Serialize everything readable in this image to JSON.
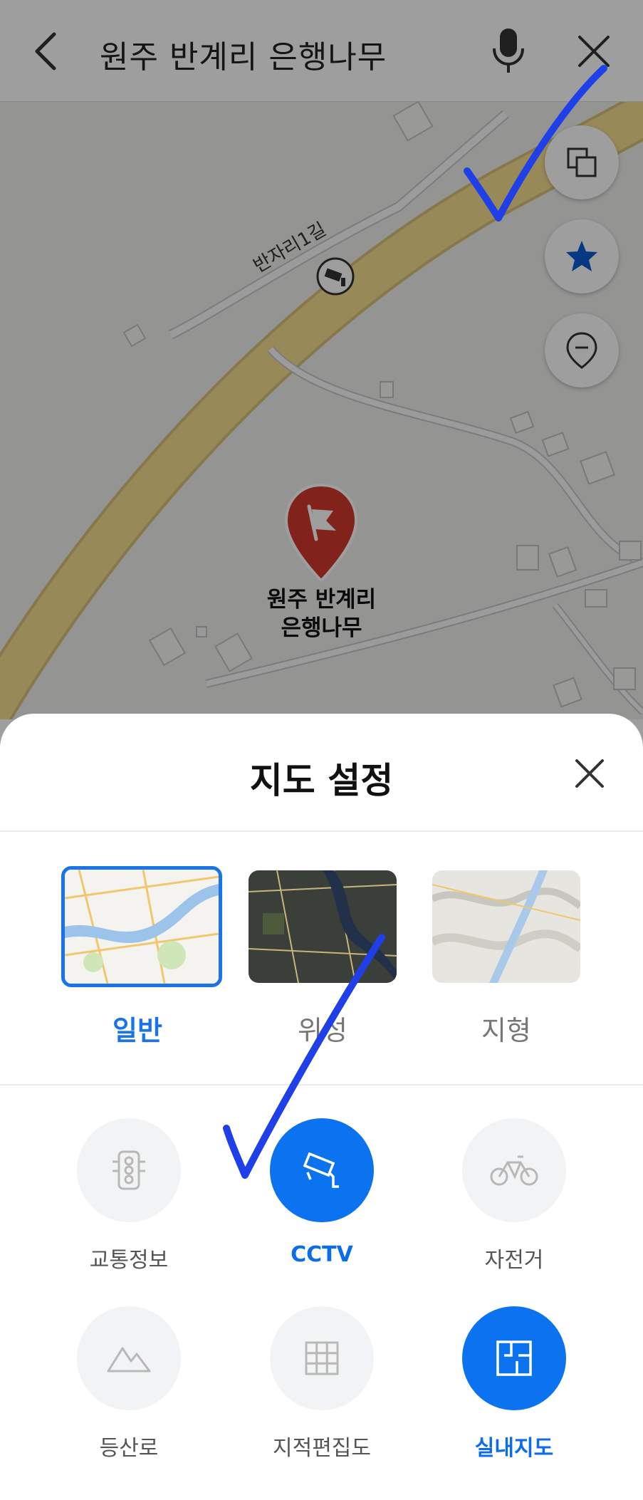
{
  "search": {
    "query": "원주 반계리 은행나무"
  },
  "map": {
    "road_label": "반자리1길",
    "place_label_line1": "원주 반계리",
    "place_label_line2": "은행나무"
  },
  "sheet": {
    "title": "지도 설정",
    "map_types": [
      {
        "label": "일반",
        "selected": true
      },
      {
        "label": "위성",
        "selected": false
      },
      {
        "label": "지형",
        "selected": false
      }
    ],
    "options": [
      {
        "label": "교통정보",
        "icon": "traffic-light-icon",
        "active": false
      },
      {
        "label": "CCTV",
        "icon": "cctv-icon",
        "active": true
      },
      {
        "label": "자전거",
        "icon": "bicycle-icon",
        "active": false
      },
      {
        "label": "등산로",
        "icon": "mountain-icon",
        "active": false
      },
      {
        "label": "지적편집도",
        "icon": "grid-icon",
        "active": false
      },
      {
        "label": "실내지도",
        "icon": "floorplan-icon",
        "active": true
      }
    ]
  },
  "colors": {
    "accent": "#0b72f0",
    "selected_text": "#1a73e8",
    "marker": "#c0392b",
    "road": "#f3d98a"
  }
}
